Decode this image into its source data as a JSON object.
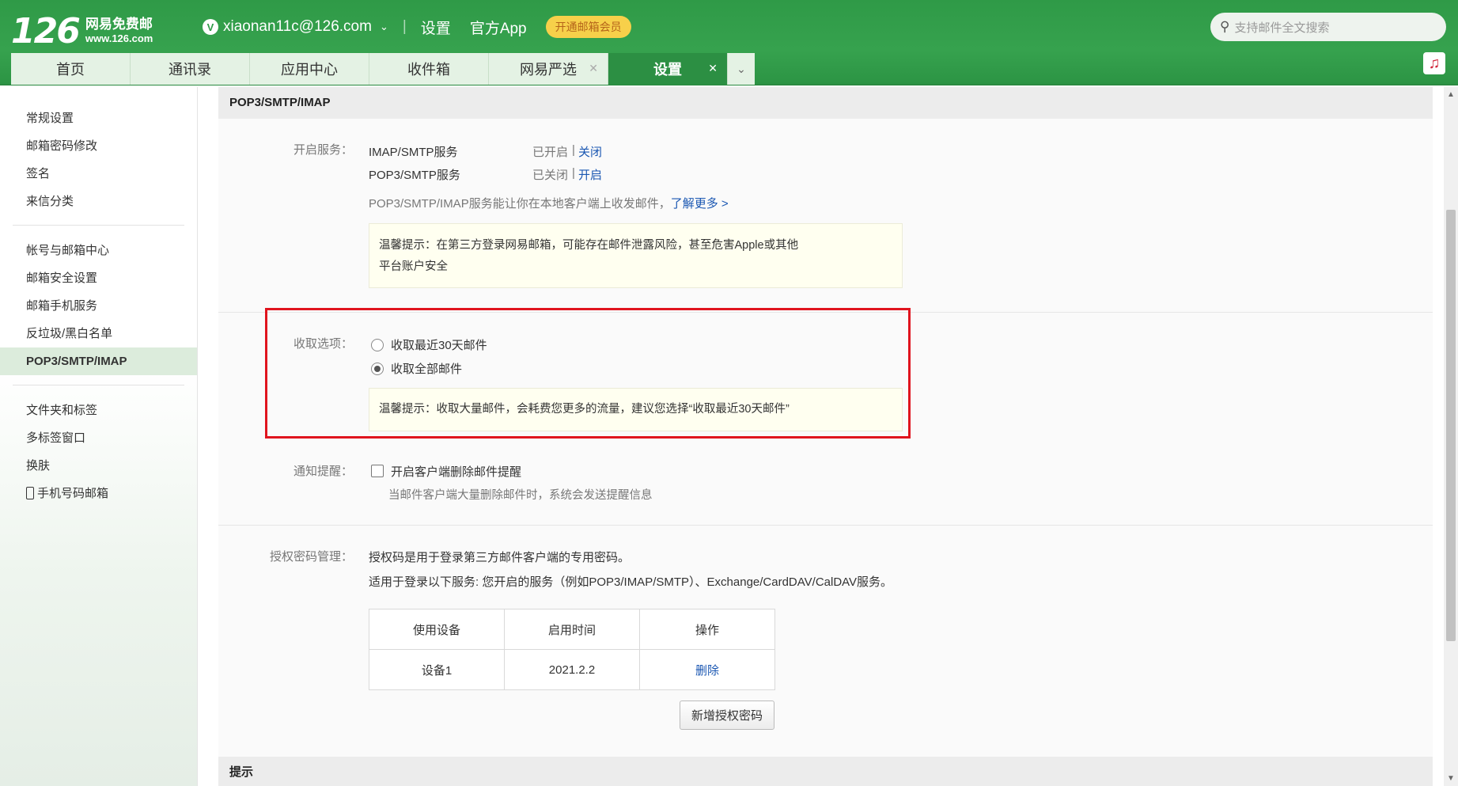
{
  "header": {
    "logo_number": "126",
    "logo_name": "网易免费邮",
    "logo_url": "www.126.com",
    "account_badge": "V",
    "account": "xiaonan11c@126.com",
    "links": [
      "设置",
      "官方App"
    ],
    "vip_button": "开通邮箱会员",
    "search_placeholder": "支持邮件全文搜索"
  },
  "tabs": [
    {
      "label": "首页",
      "closable": false,
      "active": false
    },
    {
      "label": "通讯录",
      "closable": false,
      "active": false
    },
    {
      "label": "应用中心",
      "closable": false,
      "active": false
    },
    {
      "label": "收件箱",
      "closable": false,
      "active": false
    },
    {
      "label": "网易严选",
      "closable": true,
      "active": false
    },
    {
      "label": "设置",
      "closable": true,
      "active": true
    }
  ],
  "sidebar": {
    "groups": [
      [
        "常规设置",
        "邮箱密码修改",
        "签名",
        "来信分类"
      ],
      [
        "帐号与邮箱中心",
        "邮箱安全设置",
        "邮箱手机服务",
        "反垃圾/黑白名单",
        "POP3/SMTP/IMAP"
      ],
      [
        "文件夹和标签",
        "多标签窗口",
        "换肤",
        "手机号码邮箱"
      ]
    ],
    "active": "POP3/SMTP/IMAP"
  },
  "main": {
    "section_title": "POP3/SMTP/IMAP",
    "service_label": "开启服务：",
    "services": [
      {
        "name": "IMAP/SMTP服务",
        "status": "已开启",
        "action": "关闭"
      },
      {
        "name": "POP3/SMTP服务",
        "status": "已关闭",
        "action": "开启"
      }
    ],
    "service_desc": "POP3/SMTP/IMAP服务能让你在本地客户端上收发邮件，",
    "learn_more": "了解更多 >",
    "tip1_line1": "温馨提示：在第三方登录网易邮箱，可能存在邮件泄露风险，甚至危害Apple或其他",
    "tip1_line2": "平台账户安全",
    "fetch_label": "收取选项：",
    "fetch_options": [
      {
        "label": "收取最近30天邮件",
        "checked": false
      },
      {
        "label": "收取全部邮件",
        "checked": true
      }
    ],
    "tip2": "温馨提示：收取大量邮件，会耗费您更多的流量，建议您选择“收取最近30天邮件”",
    "notify_label": "通知提醒：",
    "notify_checkbox": "开启客户端删除邮件提醒",
    "notify_desc": "当邮件客户端大量删除邮件时，系统会发送提醒信息",
    "auth_label": "授权密码管理：",
    "auth_desc1": "授权码是用于登录第三方邮件客户端的专用密码。",
    "auth_desc2": "适用于登录以下服务: 您开启的服务（例如POP3/IMAP/SMTP）、Exchange/CardDAV/CalDAV服务。",
    "table_headers": [
      "使用设备",
      "启用时间",
      "操作"
    ],
    "table_rows": [
      [
        "设备1",
        "2021.2.2",
        "删除"
      ]
    ],
    "add_button": "新增授权密码",
    "footer_title": "提示"
  }
}
